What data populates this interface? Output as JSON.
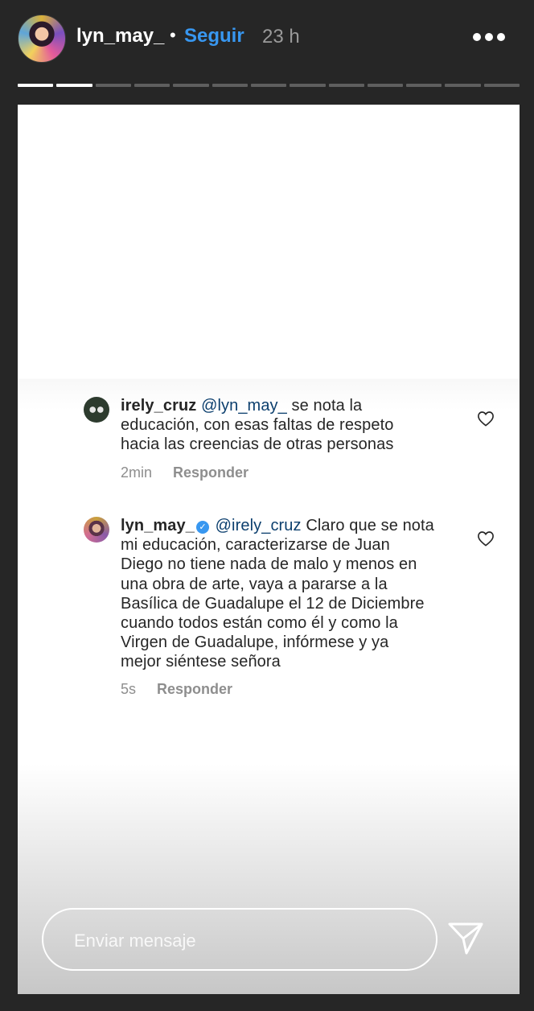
{
  "header": {
    "username": "lyn_may_",
    "separator": "•",
    "follow_label": "Seguir",
    "time": "23 h",
    "more_icon": "more-horizontal-icon"
  },
  "progress": {
    "segments": 13,
    "completed": 2
  },
  "comments": [
    {
      "user": "irely_cruz",
      "mention": "@lyn_may_",
      "text_lines": [
        "se nota la",
        "educación, con esas faltas de respeto",
        "hacia las creencias de otras personas"
      ],
      "age": "2min",
      "reply_label": "Responder"
    },
    {
      "user": "lyn_may_",
      "verified": true,
      "mention": "@irely_cruz",
      "text_lines": [
        "Claro que se nota",
        "mi educación, caracterizarse de Juan",
        "Diego no tiene nada de malo y menos en",
        "una obra de arte, vaya a pararse a la",
        "Basílica de Guadalupe el 12 de Diciembre",
        "cuando todos están como él y como la",
        "Virgen de Guadalupe, infórmese y ya",
        "mejor siéntese señora"
      ],
      "age": "5s",
      "reply_label": "Responder"
    }
  ],
  "message_bar": {
    "placeholder": "Enviar mensaje"
  },
  "colors": {
    "accent": "#3897f0",
    "background": "#262626"
  }
}
